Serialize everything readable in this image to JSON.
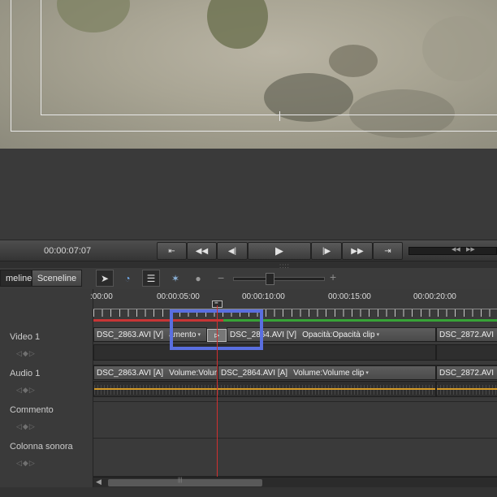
{
  "transport": {
    "timecode": "00:00:07:07",
    "buttons": [
      {
        "name": "go-to-start-button",
        "glyph": "⇤",
        "icon": "go-to-start-icon"
      },
      {
        "name": "rewind-button",
        "glyph": "◀◀",
        "icon": "rewind-icon"
      },
      {
        "name": "step-back-button",
        "glyph": "◀|",
        "icon": "step-back-icon"
      },
      {
        "name": "play-button",
        "glyph": "▶",
        "icon": "play-icon"
      },
      {
        "name": "step-forward-button",
        "glyph": "|▶",
        "icon": "step-forward-icon"
      },
      {
        "name": "fast-forward-button",
        "glyph": "▶▶",
        "icon": "fast-forward-icon"
      },
      {
        "name": "go-to-end-button",
        "glyph": "⇥",
        "icon": "go-to-end-icon"
      }
    ],
    "shuttle_left": "◀◀",
    "shuttle_right": "▶▶"
  },
  "divider_grip": "::::",
  "tabs": {
    "timeline": "meline",
    "sceneline": "Sceneline"
  },
  "tools": {
    "select": "➤",
    "time_stretch": "◔",
    "markers": "☰",
    "effects": "✶",
    "render": "●"
  },
  "zoom": {
    "minus": "−",
    "plus": "+",
    "level": 0.4
  },
  "ruler": {
    "labels": [
      ":00:00",
      "00:00:05:00",
      "00:00:10:00",
      "00:00:15:00",
      "00:00:20:00"
    ],
    "current_marker": "≡"
  },
  "tracks": [
    {
      "name": "Video 1",
      "nav": "◁◆▷"
    },
    {
      "name": "Audio 1",
      "nav": "◁◆▷"
    },
    {
      "name": "Commento",
      "nav": "◁◆▷"
    },
    {
      "name": "Colonna sonora",
      "nav": "◁◆▷"
    }
  ],
  "video_clips": [
    {
      "name": "DSC_2863.AVI [V]",
      "prop": "amento",
      "caret": "▾"
    },
    {
      "name": "DSC_2864.AVI [V]",
      "prop": "Opacità:Opacità clip",
      "caret": "▾"
    },
    {
      "name": "DSC_2872.AVI",
      "prop": "",
      "caret": ""
    }
  ],
  "audio_clips": [
    {
      "name": "DSC_2863.AVI [A]",
      "prop": "Volume:Volume clip",
      "caret": "▾"
    },
    {
      "name": "DSC_2864.AVI [A]",
      "prop": "Volume:Volume clip",
      "caret": "▾"
    },
    {
      "name": "DSC_2872.AVI",
      "prop": "",
      "caret": ""
    }
  ],
  "transition_glyph": "⊳",
  "scroll": {
    "left_arrow": "◀",
    "grip": "|||"
  },
  "colors": {
    "playhead": "#d03030",
    "highlight": "#5a6fe0",
    "volume": "#d49a27",
    "work_area": "#37a337"
  }
}
